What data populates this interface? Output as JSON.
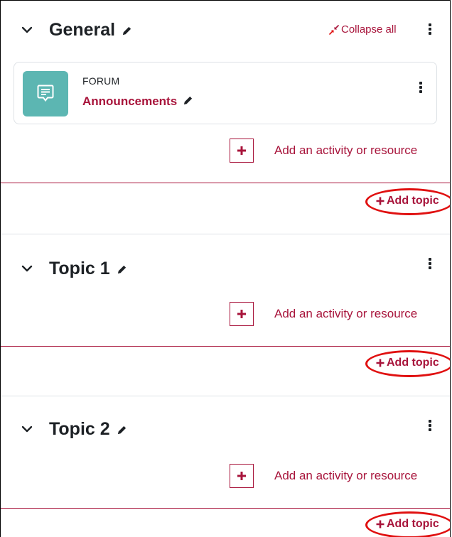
{
  "general": {
    "title": "General",
    "collapse_all_label": "Collapse all",
    "activity": {
      "type": "FORUM",
      "name": "Announcements"
    },
    "add_activity_label": "Add an activity or resource",
    "add_topic_label": "Add topic"
  },
  "topic1": {
    "title": "Topic 1",
    "add_activity_label": "Add an activity or resource",
    "add_topic_label": "Add topic"
  },
  "topic2": {
    "title": "Topic 2",
    "add_activity_label": "Add an activity or resource",
    "add_topic_label": "Add topic"
  },
  "colors": {
    "accent": "#a8143b",
    "forum_icon_bg": "#5cb6b2",
    "highlight": "#e01010",
    "divider": "#dee2e6"
  },
  "icons": {
    "chevron": "chevron-down-icon",
    "pencil": "pencil-icon",
    "kebab": "kebab-menu-icon",
    "collapse": "collapse-arrows-icon",
    "forum": "forum-chat-icon",
    "plus": "plus-icon"
  }
}
